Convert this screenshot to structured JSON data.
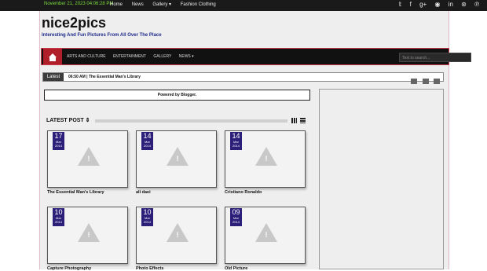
{
  "topbar": {
    "datetime": "November 21, 2023 04:06:28 PM",
    "links": [
      "Home",
      "News ",
      "Gallery ▾",
      "Fashion Clothing"
    ],
    "social_icons": [
      "twitter-icon",
      "facebook-icon",
      "google-plus-icon",
      "rss-icon",
      "linkedin-icon",
      "dribbble-icon",
      "pinterest-icon"
    ]
  },
  "header": {
    "logo": "nice2pics",
    "tagline": "Interesting And Fun Pictures From All Over The Place"
  },
  "nav": {
    "items": [
      "ARTS AND CULTURE",
      "ENTERTAINMENT",
      "GALLERY",
      "NEWS ▾"
    ],
    "search_placeholder": "Text to search..."
  },
  "ticker": {
    "label": "Latest",
    "text": "06:50 AM | The Essential Man's Library"
  },
  "powered": "Powered by Blogger.",
  "section": {
    "title": "LATEST POST ⇕"
  },
  "posts": [
    {
      "day": "17",
      "month": "Mar",
      "year": "2014",
      "title": "The Essential Man's Library"
    },
    {
      "day": "14",
      "month": "Mar",
      "year": "2014",
      "title": "ali daei"
    },
    {
      "day": "14",
      "month": "Mar",
      "year": "2014",
      "title": "Cristiano Ronaldo"
    },
    {
      "day": "10",
      "month": "Mar",
      "year": "2014",
      "title": "Capture Photography"
    },
    {
      "day": "10",
      "month": "Mar",
      "year": "2014",
      "title": "Photo Effects"
    },
    {
      "day": "09",
      "month": "Mar",
      "year": "2014",
      "title": "Old Picture"
    }
  ]
}
